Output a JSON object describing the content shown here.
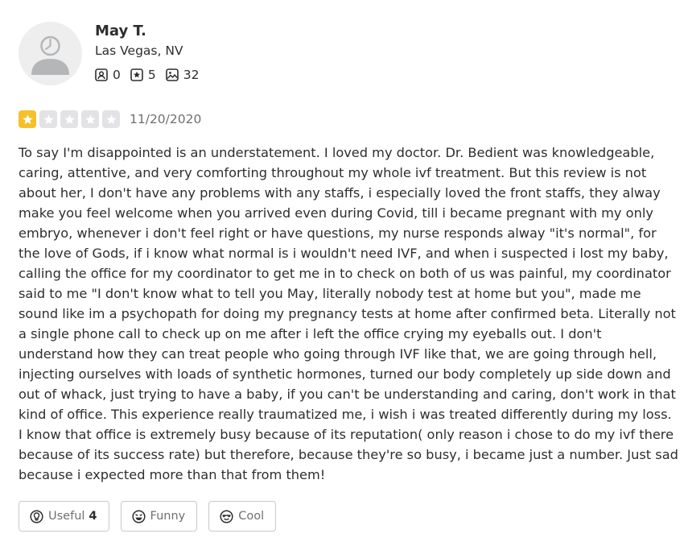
{
  "user": {
    "name": "May T.",
    "location": "Las Vegas, NV",
    "stats": {
      "friends": "0",
      "reviews": "5",
      "photos": "32"
    },
    "friends_icon": "friends-icon",
    "reviews_icon": "star-review-icon",
    "photos_icon": "photo-icon"
  },
  "review": {
    "rating": 1,
    "rating_max": 5,
    "star_color": "#f5c12b",
    "date": "11/20/2020",
    "text": "To say I'm disappointed is an understatement. I loved my doctor. Dr. Bedient was knowledgeable, caring, attentive, and very comforting throughout my whole ivf treatment. But this review is not about her, I don't have any problems with any staffs, i especially loved the front staffs, they alway make you feel welcome when you arrived even during Covid, till i became pregnant with my only embryo, whenever i don't feel right or have questions, my nurse responds alway \"it's normal\", for the love of Gods, if i know what normal is i wouldn't need IVF, and when i suspected i lost my baby, calling the office for my coordinator to get me in to check on both of us was painful, my coordinator said to me \"I don't know what to tell you May, literally nobody test at home but you\", made me sound like im a psychopath for doing my pregnancy tests at home after confirmed beta. Literally not a single phone call to check up on me after i left the office crying my eyeballs out. I don't understand how they can treat people who going through IVF like that, we are going through hell, injecting ourselves with loads of synthetic hormones, turned our body completely up side down and out of whack, just trying to have a baby, if you can't be understanding and caring, don't work in that kind of office. This experience really traumatized me, i wish i was treated differently during my loss. I know that office is extremely busy because of its reputation( only reason i chose to do my ivf there because of its success rate) but therefore, because they're so busy, i became just a number. Just sad because i expected more than that from them!"
  },
  "reactions": {
    "useful_label": "Useful",
    "useful_count": "4",
    "funny_label": "Funny",
    "cool_label": "Cool"
  }
}
